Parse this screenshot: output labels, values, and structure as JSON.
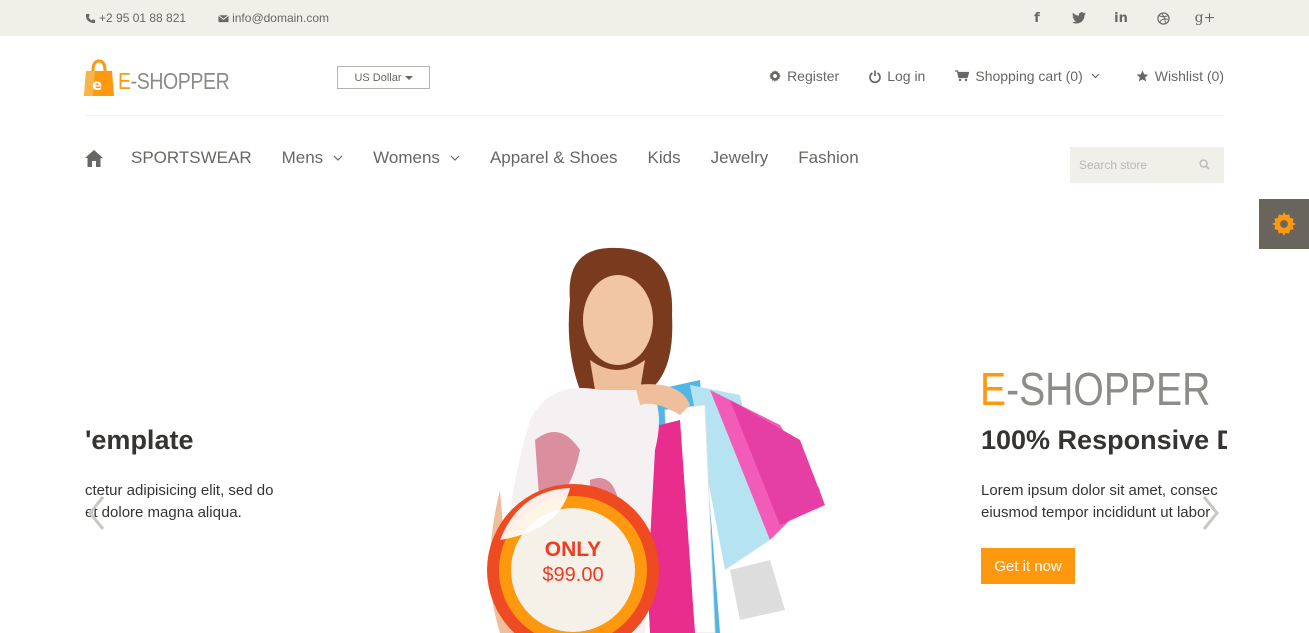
{
  "topbar": {
    "phone": "+2 95 01 88 821",
    "email": "info@domain.com",
    "social": [
      "facebook-icon",
      "twitter-icon",
      "linkedin-icon",
      "dribbble-icon",
      "google-plus-icon"
    ],
    "social_glyphs": [
      "f",
      "",
      "in",
      "",
      "g+"
    ]
  },
  "logo": {
    "first": "E",
    "rest": "-SHOPPER",
    "bag_letter": "e"
  },
  "currency": {
    "label": "US Dollar"
  },
  "usermenu": {
    "register": "Register",
    "login": "Log in",
    "cart": "Shopping cart (0)",
    "wishlist": "Wishlist (0)"
  },
  "nav": {
    "items": [
      "SPORTSWEAR",
      "Mens",
      "Womens",
      "Apparel & Shoes",
      "Kids",
      "Jewelry",
      "Fashion"
    ]
  },
  "search": {
    "placeholder": "Search store"
  },
  "slider": {
    "left": {
      "title": "'emplate",
      "line1": "ctetur adipisicing elit, sed do",
      "line2": "et dolore magna aliqua."
    },
    "right": {
      "brand_first": "E",
      "brand_rest": "-SHOPPER",
      "title": "100% Responsive D",
      "line1": "Lorem ipsum dolor sit amet, consec",
      "line2": "eiusmod tempor incididunt ut labor",
      "button": "Get it now"
    },
    "badge": {
      "top": "ONLY",
      "price": "$99.00"
    }
  },
  "colors": {
    "accent": "#fe980f",
    "text": "#696763",
    "dark": "#363432",
    "topbar": "#f0f0e9"
  }
}
